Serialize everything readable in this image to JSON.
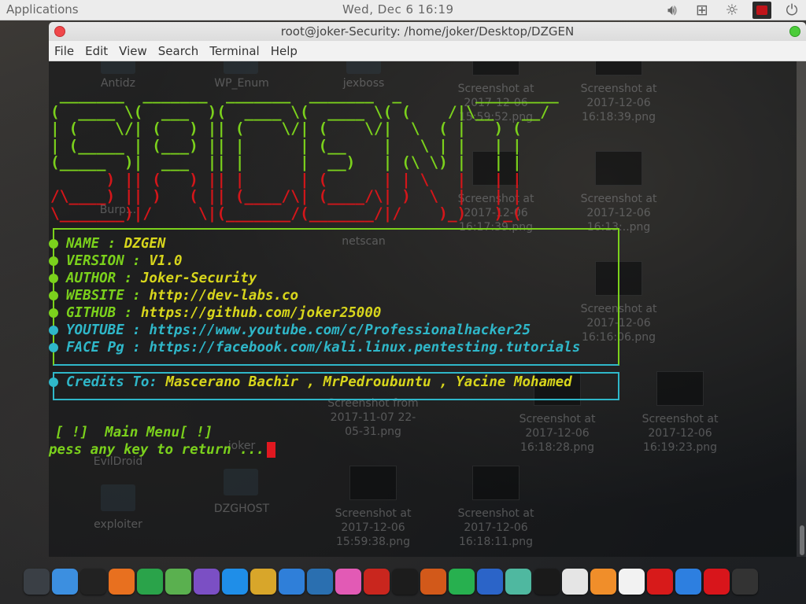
{
  "top_panel": {
    "applications_label": "Applications",
    "clock": "Wed, Dec  6  16:19",
    "tray_icons": [
      "volume-icon",
      "network-icon",
      "brightness-icon",
      "screen-recorder-icon",
      "power-icon"
    ]
  },
  "desktop": {
    "icons": [
      {
        "label": "Antidz"
      },
      {
        "label": "WP_Enum"
      },
      {
        "label": "jexboss"
      },
      {
        "label": "Screenshot at\n2017-12-06\n15:59:52.png"
      },
      {
        "label": "Screenshot at\n2017-12-06\n16:18:39.png"
      },
      {
        "label": "Burp..."
      },
      {
        "label": "netscan"
      },
      {
        "label": "Screenshot at\n2017-12-06\n16:17:39.png"
      },
      {
        "label": "Screenshot at\n2017-12-06\n16:13:..png"
      },
      {
        "label": "Screenshot at\n2017-12-06\n16:16:06.png"
      },
      {
        "label": "Screenshot from\n2017-11-07 22-\n05-31.png"
      },
      {
        "label": "Screenshot at\n2017-12-06\n16:18:28.png"
      },
      {
        "label": "Screenshot at\n2017-12-06\n16:19:23.png"
      },
      {
        "label": "EvilDroid"
      },
      {
        "label": "joker"
      },
      {
        "label": "exploiter"
      },
      {
        "label": "DZGHOST"
      },
      {
        "label": "Screenshot at\n2017-12-06\n15:59:38.png"
      },
      {
        "label": "Screenshot at\n2017-12-06\n16:18:11.png"
      }
    ]
  },
  "window": {
    "title": "root@joker-Security: /home/joker/Desktop/DZGEN",
    "menu": [
      "File",
      "Edit",
      "View",
      "Search",
      "Terminal",
      "Help"
    ]
  },
  "terminal": {
    "ascii_banner_green": " _______  _______  _______  _______  _        _________ \n(  ____ \\(  ___  )(  ____ \\(  ____ \\( (    /|\\__   __/ \n| (    \\/| (   ) || (    \\/| (    \\/|  \\  ( |   ) (    \n| (_____ | (___) || |      | (__    |   \\ | |   | |    \n(_____  )|  ___  || |      |  __)   | (\\ \\) |   | |    ",
    "ascii_banner_red": "      ) || (   ) || |      | (      | | \\   |   | |    \n/\\____) || )   ( || (____/\\| (____/\\| )  \\  |   | |    \n\\_______)|/     \\|(_______/(_______/|/    )_)   )_(    ",
    "info": [
      {
        "label": "NAME    ",
        "sep": " : ",
        "value": "DZGEN",
        "value_color": "yellow"
      },
      {
        "label": "VERSION ",
        "sep": ": ",
        "value": "V1.0",
        "value_color": "yellow"
      },
      {
        "label": "AUTHOR  ",
        "sep": ": ",
        "value": "Joker-Security",
        "value_color": "yellow"
      },
      {
        "label": "WEBSITE ",
        "sep": ": ",
        "value": "http://dev-labs.co",
        "value_color": "yellow"
      },
      {
        "label": "GITHUB  ",
        "sep": ": ",
        "value": "https://github.com/joker25000",
        "value_color": "yellow"
      },
      {
        "label": "YOUTUBE ",
        "sep": ": ",
        "value": "https://www.youtube.com/c/Professionalhacker25",
        "value_color": "cyan"
      },
      {
        "label": "FACE Pg ",
        "sep": ": ",
        "value": "https://facebook.com/kali.linux.pentesting.tutorials",
        "value_color": "cyan"
      }
    ],
    "credits_label": "Credits To: ",
    "credits_value": "Mascerano Bachir , MrPedroubuntu , Yacine Mohamed",
    "main_menu": "[ !]  Main Menu[ !]",
    "prompt": "pess any key to return ..."
  },
  "dock": {
    "apps": [
      {
        "name": "system-monitor-icon",
        "color": "#3a3f45"
      },
      {
        "name": "finder-icon",
        "color": "#3c8fe0"
      },
      {
        "name": "terminal-icon",
        "color": "#222222"
      },
      {
        "name": "firefox-icon",
        "color": "#e8701f"
      },
      {
        "name": "chrome-icon",
        "color": "#2aa34a"
      },
      {
        "name": "globe-icon",
        "color": "#5ab04f"
      },
      {
        "name": "viber-icon",
        "color": "#7b4fc4"
      },
      {
        "name": "app-store-icon",
        "color": "#1f8ee8"
      },
      {
        "name": "code-editor-icon",
        "color": "#d8a62a"
      },
      {
        "name": "atom-icon",
        "color": "#2f7fd9"
      },
      {
        "name": "browser-icon",
        "color": "#2a6fb0"
      },
      {
        "name": "itunes-icon",
        "color": "#e25ab5"
      },
      {
        "name": "filezilla-icon",
        "color": "#c9261e"
      },
      {
        "name": "bull-icon",
        "color": "#1c1c1c"
      },
      {
        "name": "mask-icon",
        "color": "#d2591a"
      },
      {
        "name": "lightning-icon",
        "color": "#27b04f"
      },
      {
        "name": "malwarebytes-icon",
        "color": "#2b64c8"
      },
      {
        "name": "anime-icon",
        "color": "#4fb8a0"
      },
      {
        "name": "matrix-icon",
        "color": "#1a1a1a"
      },
      {
        "name": "palette-icon",
        "color": "#e5e5e5"
      },
      {
        "name": "sublime-icon",
        "color": "#f08e2a"
      },
      {
        "name": "notes-icon",
        "color": "#f2f2f2"
      },
      {
        "name": "ruby-icon",
        "color": "#d71a1a"
      },
      {
        "name": "settings-panel-icon",
        "color": "#2d7fe0"
      },
      {
        "name": "record-icon",
        "color": "#d8151b"
      },
      {
        "name": "video-editor-icon",
        "color": "#333333"
      }
    ]
  },
  "colors": {
    "green": "#7bd11c",
    "red": "#d4161a",
    "cyan": "#2fb7c9",
    "yellow": "#d8d61c",
    "cursor": "#e01820"
  }
}
